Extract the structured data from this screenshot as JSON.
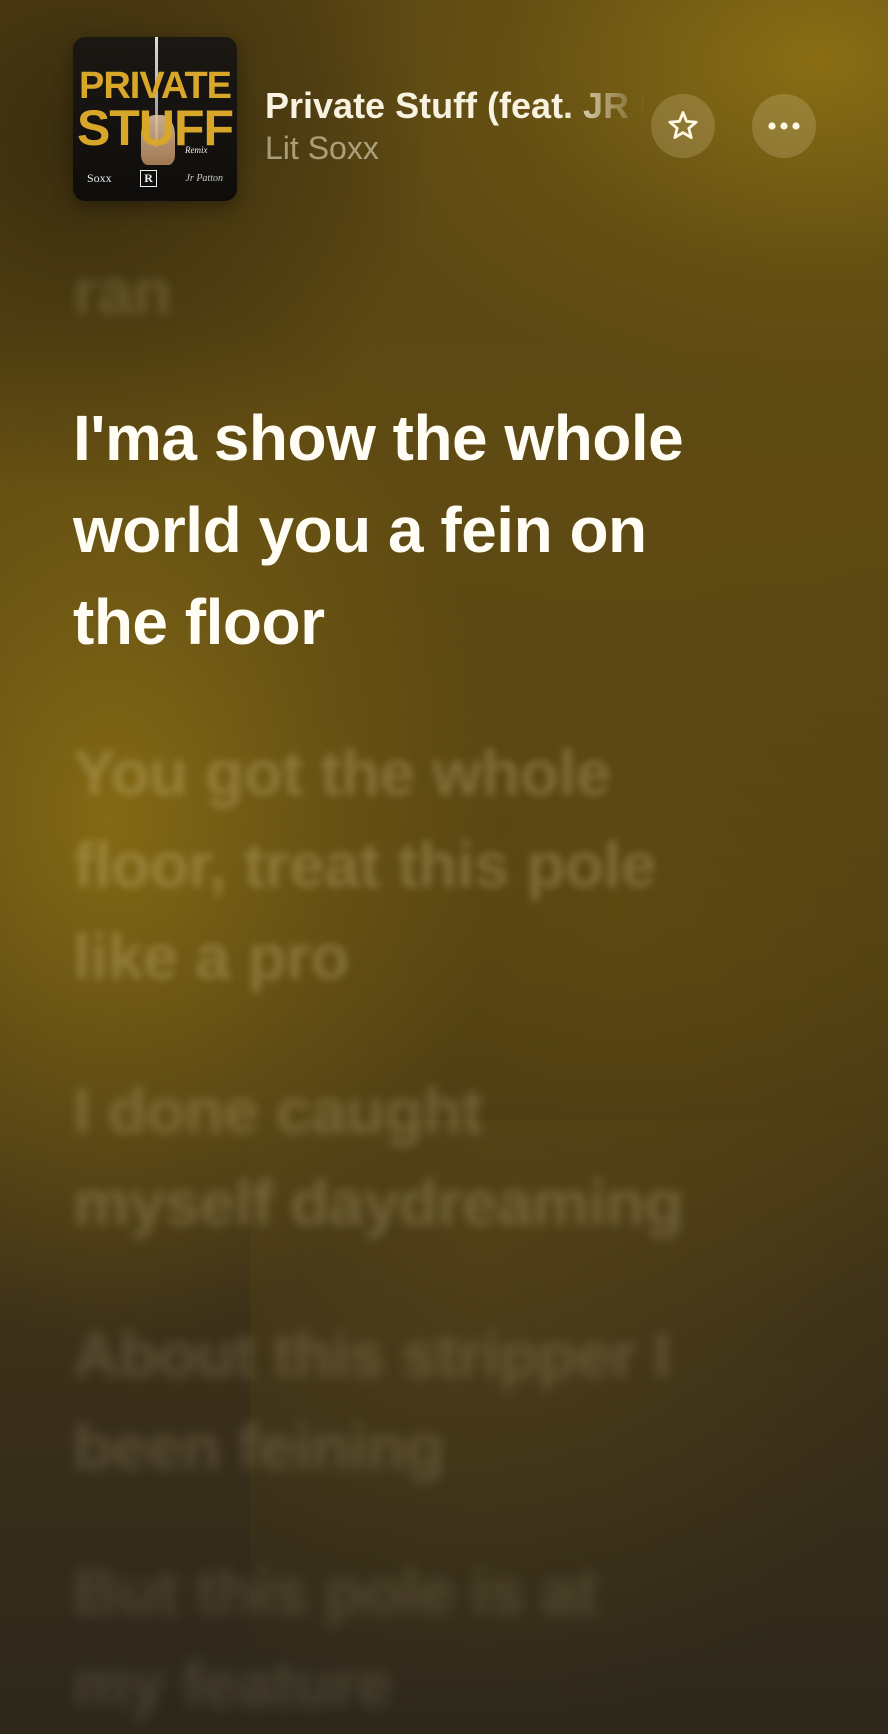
{
  "now_playing": {
    "title": "Private Stuff (feat. JR Patton)",
    "artist": "Lit Soxx",
    "artwork": {
      "title_line_1": "PRIVATE",
      "title_line_2": "STUFF",
      "left_credit": "Soxx",
      "rating_mark": "R",
      "right_credit": "Jr Patton",
      "subtitle": "Remix",
      "accent_color": "#d8a72a"
    }
  },
  "actions": {
    "favorite_icon": "star-icon",
    "more_icon": "ellipsis-icon"
  },
  "lyrics": {
    "previous": "ran",
    "current": "I'ma show the whole\nworld you a fein on\nthe floor",
    "upcoming": [
      "You got the whole\nfloor, treat this pole\nlike a pro",
      "I done caught\nmyself daydreaming",
      "About this stripper I\nbeen feining",
      "But this pole is at\nmy feature"
    ]
  },
  "colors": {
    "background_gold": "#8c7014",
    "background_dark": "#2d271c",
    "active_lyric": "#fffdf4"
  }
}
